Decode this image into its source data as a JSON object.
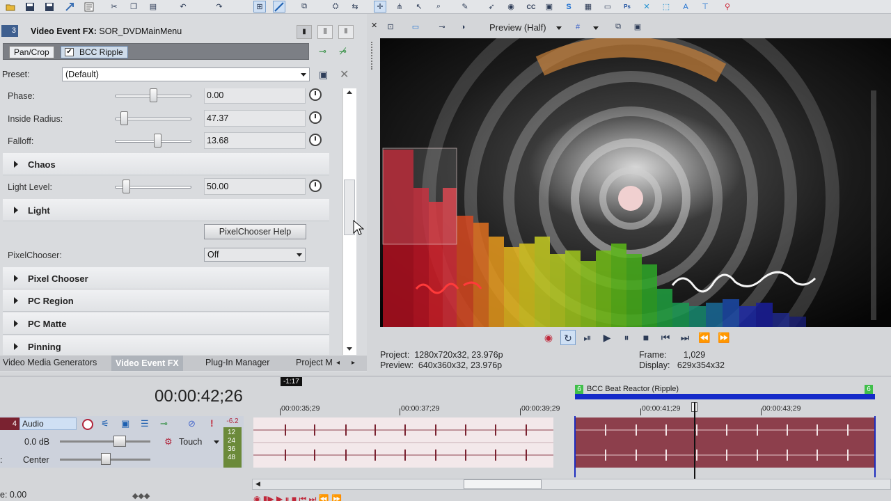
{
  "fx_panel": {
    "track_number": "3",
    "title_prefix": "Video Event FX:",
    "title_name": "SOR_DVDMainMenu",
    "chain": [
      "Pan/Crop",
      "BCC Ripple"
    ],
    "preset_label": "Preset:",
    "preset_value": "(Default)",
    "properties": [
      {
        "type": "slider",
        "label": "Phase:",
        "value": "0.00",
        "fraction": 0.5
      },
      {
        "type": "slider",
        "label": "Inside Radius:",
        "value": "47.37",
        "fraction": 0.08
      },
      {
        "type": "slider",
        "label": "Falloff:",
        "value": "13.68",
        "fraction": 0.57
      },
      {
        "type": "group",
        "label": "Chaos"
      },
      {
        "type": "slider",
        "label": "Light Level:",
        "value": "50.00",
        "fraction": 0.11
      },
      {
        "type": "group",
        "label": "Light"
      },
      {
        "type": "button",
        "label": "PixelChooser Help"
      },
      {
        "type": "combo",
        "label": "PixelChooser:",
        "value": "Off"
      },
      {
        "type": "group",
        "label": "Pixel Chooser"
      },
      {
        "type": "group",
        "label": "PC Region"
      },
      {
        "type": "group",
        "label": "PC Matte"
      },
      {
        "type": "group",
        "label": "Pinning"
      }
    ],
    "tabs": [
      "Video Media Generators",
      "Video Event FX",
      "Plug-In Manager",
      "Project M"
    ]
  },
  "preview": {
    "quality": "Preview (Half)",
    "project_label": "Project:",
    "project_value": "1280x720x32, 23.976p",
    "preview_label": "Preview:",
    "preview_value": "640x360x32, 23.976p",
    "frame_label": "Frame:",
    "frame_value": "1,029",
    "display_label": "Display:",
    "display_value": "629x354x32"
  },
  "timeline": {
    "timecode": "00:00:42;26",
    "offset_badge": "-1:17",
    "track_number": "4",
    "track_name": "Audio",
    "volume": "0.0 dB",
    "pan": "Center",
    "automation": "Touch",
    "vu_peak": "-6.2",
    "vu_scale": [
      "12",
      "24",
      "36",
      "48"
    ],
    "rate_label": "e: 0.00",
    "region_name": "BCC Beat Reactor (Ripple)",
    "region_marker": "6",
    "ruler": [
      "00:00:35;29",
      "00:00:37;29",
      "00:00:39;29",
      "00:00:41;29",
      "00:00:43;29"
    ]
  },
  "colors": {
    "track_accent": "#7a2230",
    "region_bar": "#152ac9",
    "marker": "#3fbf4a",
    "clip_selected": "#8d3f4c"
  }
}
